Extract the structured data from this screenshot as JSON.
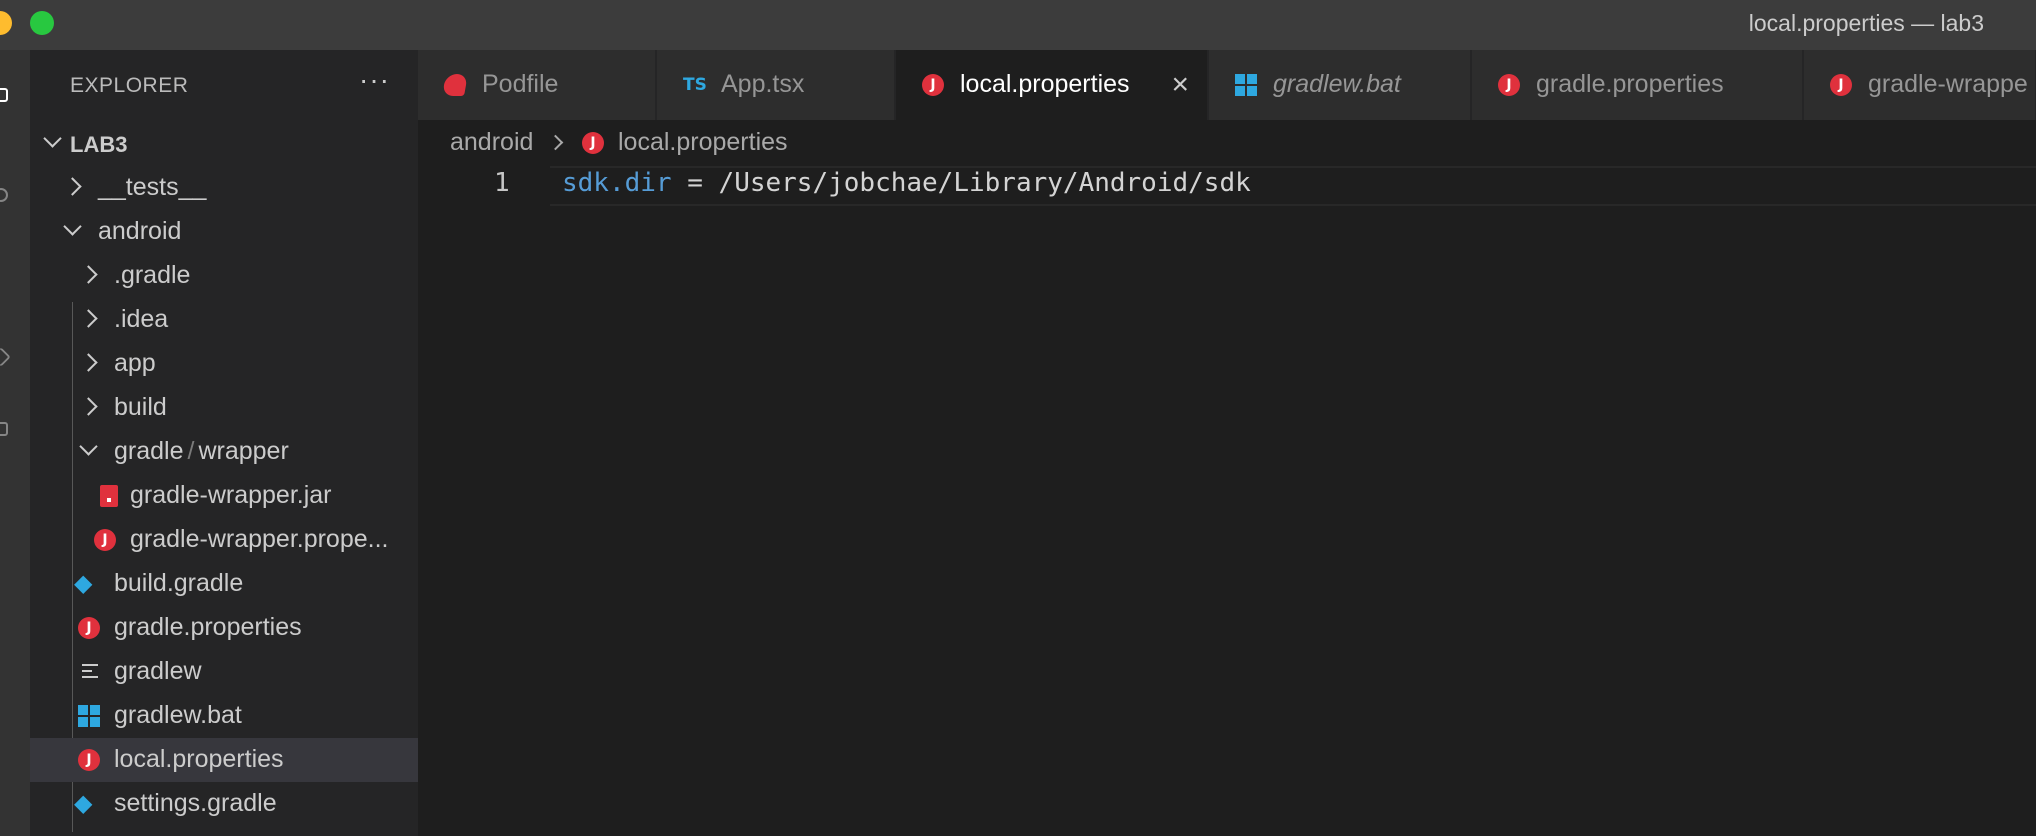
{
  "window": {
    "title": "local.properties — lab3"
  },
  "sidebar": {
    "header": "EXPLORER",
    "more": "···",
    "root": "LAB3",
    "tree": [
      {
        "label": "__tests__"
      },
      {
        "label": "android"
      },
      {
        "label": ".gradle"
      },
      {
        "label": ".idea"
      },
      {
        "label": "app"
      },
      {
        "label": "build"
      },
      {
        "label_a": "gradle",
        "sep": "/",
        "label_b": "wrapper"
      },
      {
        "label": "gradle-wrapper.jar"
      },
      {
        "label": "gradle-wrapper.prope..."
      },
      {
        "label": "build.gradle"
      },
      {
        "label": "gradle.properties"
      },
      {
        "label": "gradlew"
      },
      {
        "label": "gradlew.bat"
      },
      {
        "label": "local.properties"
      },
      {
        "label": "settings.gradle"
      }
    ]
  },
  "tabs": [
    {
      "label": "Podfile",
      "icon": "podfile-icon"
    },
    {
      "label": "App.tsx",
      "icon": "typescript-icon",
      "icon_text": "TS"
    },
    {
      "label": "local.properties",
      "icon": "java-properties-icon",
      "active": true
    },
    {
      "label": "gradlew.bat",
      "icon": "windows-icon"
    },
    {
      "label": "gradle.properties",
      "icon": "java-properties-icon"
    },
    {
      "label": "gradle-wrappe",
      "icon": "java-properties-icon"
    }
  ],
  "icons": {
    "j": "J"
  },
  "breadcrumb": {
    "folder": "android",
    "file": "local.properties"
  },
  "editor": {
    "line_number": "1",
    "code_key": "sdk.dir",
    "code_rest": " = /Users/jobchae/Library/Android/sdk"
  },
  "colors": {
    "accent_red": "#e0313d",
    "accent_blue": "#2ea8e0",
    "code_key": "#569cd6"
  }
}
